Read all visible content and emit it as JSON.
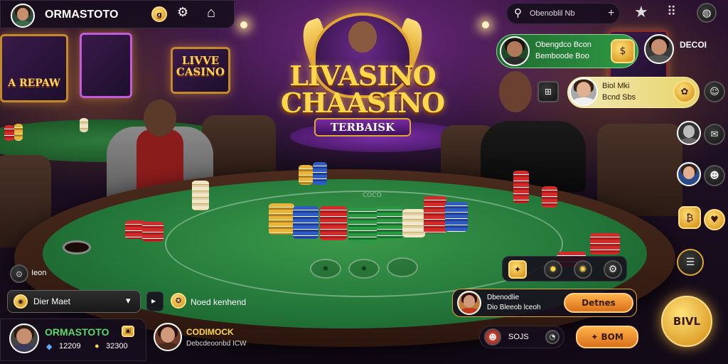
{
  "colors": {
    "felt": "#24783a",
    "gold": "#ffd84a",
    "accent_orange": "#d9701a",
    "panel_bg": "#160e1c"
  },
  "top_bar": {
    "player_name": "ORMASTOTO",
    "coin_icon_text": "g",
    "home_icon": "home-icon",
    "settings_icon": "gear-icon"
  },
  "top_right": {
    "search_value": "Obenoblil Nb",
    "search_add": "+",
    "star_icon": "star-icon",
    "grid_icon": "grid-icon",
    "globe_icon": "globe-icon"
  },
  "wall_signs": {
    "left": "A REPAW",
    "center_line1": "LIVVE",
    "center_line2": "CASINO"
  },
  "logo": {
    "line1": "LIVASINO",
    "line2": "CHAASINO",
    "banner": "TERBAISK"
  },
  "felt": {
    "label": "COCO",
    "spot_labels": [
      "✱",
      "✱",
      ""
    ]
  },
  "right_players": [
    {
      "title": "Obengdco Bcon",
      "subtitle": "Bemboode Boo"
    },
    {
      "title": "Biol Mki",
      "subtitle": "Bcnd Sbs"
    }
  ],
  "right_top_label": "DECOI",
  "table_controls": {
    "left_chip_label": "Ieon",
    "dropdown_label": "Dier Maet",
    "dropdown_icon": "chevron-down-icon",
    "arrow_label": "",
    "mode_label": "Noed kenhend"
  },
  "notification": {
    "line1": "Dbenodlie",
    "line2": "Dio Bleeob lceoh",
    "button": "Detnes"
  },
  "bottom_bar": {
    "player_name": "ORMASTOTO",
    "stat1": "12209",
    "stat2": "32300",
    "opponent_name": "CODIMOCK",
    "opponent_sub": "Debcdeoonbd ICW",
    "sojs_label": "SOJS",
    "bom_label": "BOM",
    "big_button": "BIVL"
  }
}
